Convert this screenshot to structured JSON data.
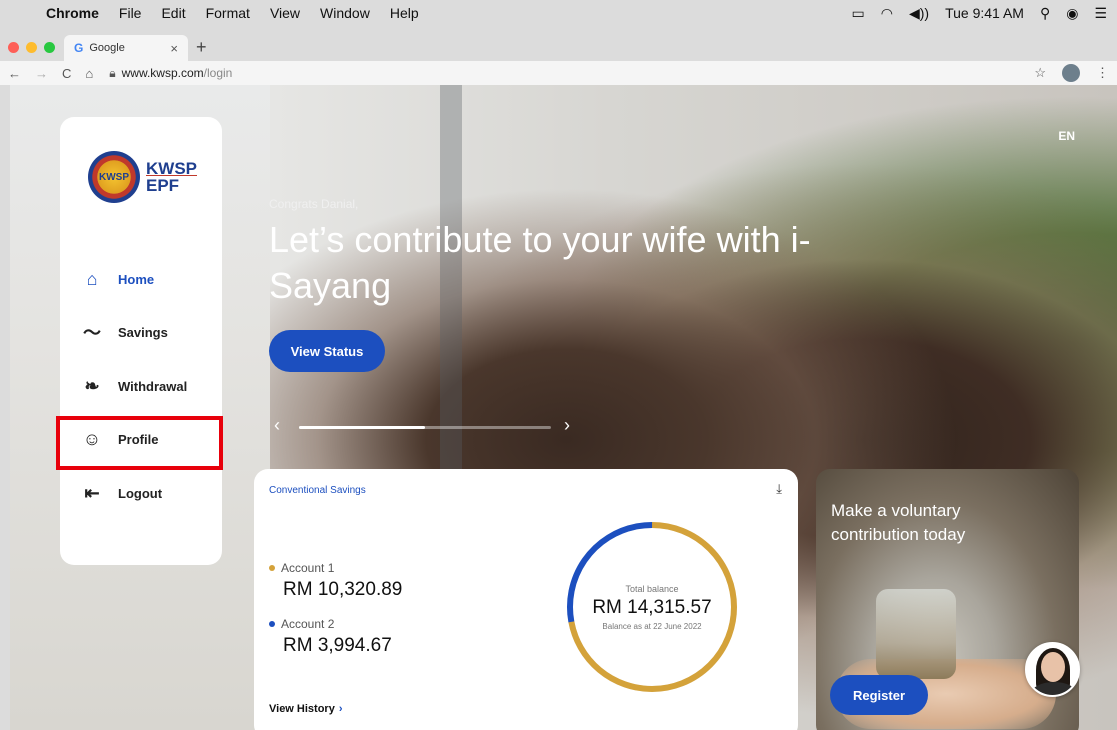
{
  "menubar": {
    "apple_icon": "apple-logo",
    "items": [
      "Chrome",
      "File",
      "Edit",
      "Format",
      "View",
      "Window",
      "Help"
    ],
    "clock": "Tue 9:41 AM",
    "volume": "◀))"
  },
  "browser": {
    "tab_title": "Google",
    "tab_favicon": "G",
    "url_host": "www.kwsp.com",
    "url_path": "/login",
    "traffic_colors": [
      "#fe5f57",
      "#febc2e",
      "#28c840"
    ]
  },
  "page": {
    "lang": "EN",
    "greeting": "Congrats Danial,",
    "headline": "Let’s contribute to your wife with i-Sayang",
    "view_status_label": "View Status",
    "carousel_progress": 0.5,
    "logo": {
      "line1": "KWSP",
      "line2": "EPF",
      "seal_text": "KWSP"
    },
    "nav": [
      {
        "label": "Home",
        "icon": "home-icon",
        "active": true
      },
      {
        "label": "Savings",
        "icon": "chart-line-icon",
        "active": false
      },
      {
        "label": "Withdrawal",
        "icon": "leaf-icon",
        "active": false
      },
      {
        "label": "Profile",
        "icon": "user-icon",
        "active": false
      },
      {
        "label": "Logout",
        "icon": "logout-icon",
        "active": false
      }
    ],
    "savings": {
      "title": "Conventional Savings",
      "account1_label": "Account 1",
      "account1_amount": "RM 10,320.89",
      "account2_label": "Account 2",
      "account2_amount": "RM 3,994.67",
      "total_label": "Total balance",
      "total_amount": "RM 14,315.57",
      "as_at": "Balance as at 22 June 2022",
      "view_history": "View History",
      "colors": {
        "account1": "#d4a23a",
        "account2": "#1c4fbf"
      },
      "account1_share": 0.721,
      "account2_share": 0.279
    },
    "promo": {
      "text": "Make a voluntary contribution today",
      "register_label": "Register"
    }
  }
}
